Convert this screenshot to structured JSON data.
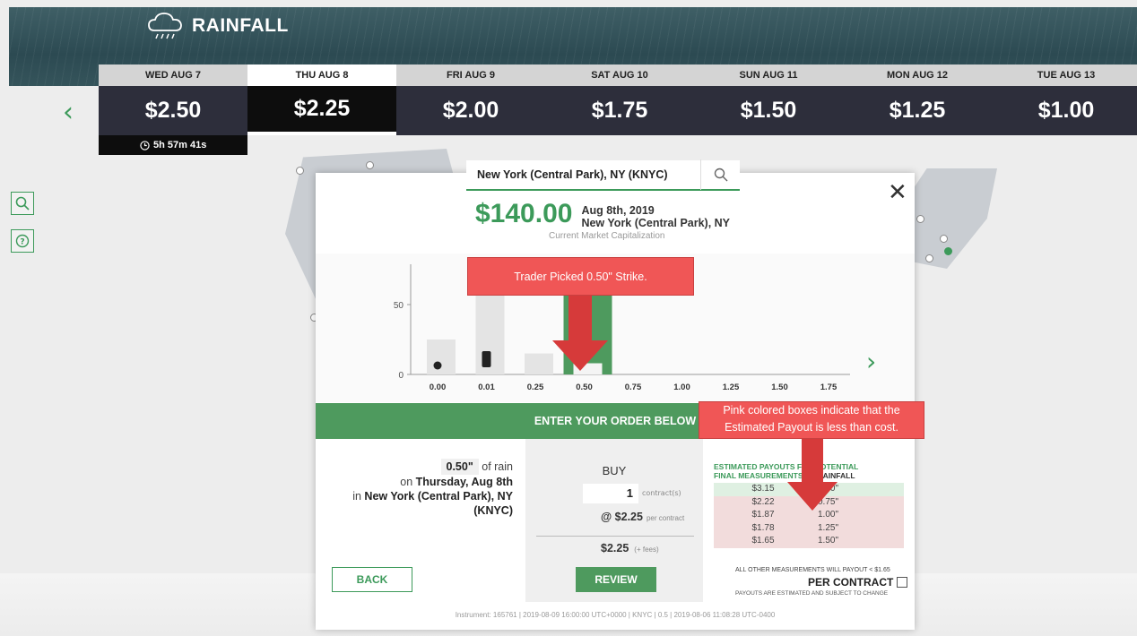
{
  "header": {
    "app_name": "RAINFALL",
    "logo_icon": "rain-cloud-icon"
  },
  "days": [
    {
      "label": "WED AUG 7",
      "price": "$2.50"
    },
    {
      "label": "THU AUG 8",
      "price": "$2.25",
      "active": true
    },
    {
      "label": "FRI AUG 9",
      "price": "$2.00"
    },
    {
      "label": "SAT AUG 10",
      "price": "$1.75"
    },
    {
      "label": "SUN AUG 11",
      "price": "$1.50"
    },
    {
      "label": "MON AUG 12",
      "price": "$1.25"
    },
    {
      "label": "TUE AUG 13",
      "price": "$1.00"
    }
  ],
  "timer": "5h 57m 41s",
  "search": {
    "value": "New York (Central Park), NY (KNYC)"
  },
  "market": {
    "cap_value": "$140.00",
    "date": "Aug 8th, 2019",
    "location": "New York (Central Park), NY",
    "cap_label": "Current Market Capitalization"
  },
  "chart_data": {
    "type": "bar",
    "categories": [
      "0.00",
      "0.01",
      "0.25",
      "0.50",
      "0.75",
      "1.00",
      "1.25",
      "1.50",
      "1.75"
    ],
    "values": [
      25,
      62,
      15,
      8,
      0,
      0,
      0,
      0,
      0
    ],
    "ylim": [
      0,
      75
    ],
    "y_ticks": [
      "0",
      "50"
    ],
    "highlight_category": "0.50"
  },
  "order_band": "ENTER YOUR ORDER BELOW",
  "order": {
    "amount": "0.50\"",
    "of_rain": "of rain",
    "on_text": "on",
    "day": "Thursday, Aug 8th",
    "in_text": "in",
    "location": "New York (Central Park), NY",
    "code": "(KNYC)",
    "back": "BACK",
    "side": "BUY",
    "quantity": "1",
    "quantity_unit": "contract(s)",
    "price": "@ $2.25",
    "price_unit": "per contract",
    "total": "$2.25",
    "total_unit": "(+ fees)",
    "review": "REVIEW"
  },
  "payouts": {
    "head_line1": "ESTIMATED PAYOUTS FOR POTENTIAL",
    "head_line2": "FINAL MEASUREMENTS",
    "head_rainfall": "RAINFALL",
    "rows": [
      {
        "payout": "$3.15",
        "measurement": "0.50\"",
        "status": "ok"
      },
      {
        "payout": "$2.22",
        "measurement": "0.75\"",
        "status": "bad"
      },
      {
        "payout": "$1.87",
        "measurement": "1.00\"",
        "status": "bad"
      },
      {
        "payout": "$1.78",
        "measurement": "1.25\"",
        "status": "bad"
      },
      {
        "payout": "$1.65",
        "measurement": "1.50\"",
        "status": "bad"
      }
    ],
    "other_note": "ALL OTHER MEASUREMENTS WILL PAYOUT < $1.65",
    "per_contract": "PER CONTRACT",
    "estimate_note": "PAYOUTS ARE ESTIMATED AND SUBJECT TO CHANGE"
  },
  "instrument": "Instrument: 165761 | 2019-08-09 16:00:00 UTC+0000 | KNYC | 0.5 | 2019-08-06 11:08:28 UTC-0400",
  "annotations": {
    "strike": "Trader Picked 0.50\" Strike.",
    "pink_line1": "Pink colored boxes indicate that the",
    "pink_line2": "Estimated Payout is less than cost."
  },
  "colors": {
    "accent": "#3c9a5a",
    "dark_tab": "#2d2e3b",
    "annotation": "#f05656"
  }
}
